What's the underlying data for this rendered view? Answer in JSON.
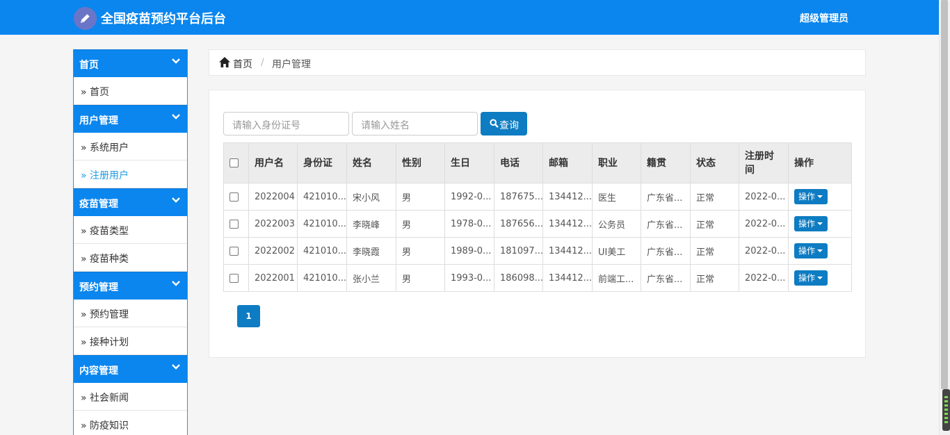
{
  "app": {
    "title": "全国疫苗预约平台后台",
    "user": "超级管理员",
    "logo_icon": "pencil-icon"
  },
  "sidebar": {
    "groups": [
      {
        "label": "首页",
        "items": [
          {
            "label": "首页"
          }
        ]
      },
      {
        "label": "用户管理",
        "items": [
          {
            "label": "系统用户"
          },
          {
            "label": "注册用户",
            "active": true
          }
        ]
      },
      {
        "label": "疫苗管理",
        "items": [
          {
            "label": "疫苗类型"
          },
          {
            "label": "疫苗种类"
          }
        ]
      },
      {
        "label": "预约管理",
        "items": [
          {
            "label": "预约管理"
          },
          {
            "label": "接种计划"
          }
        ]
      },
      {
        "label": "内容管理",
        "items": [
          {
            "label": "社会新闻"
          },
          {
            "label": "防疫知识"
          }
        ]
      }
    ]
  },
  "breadcrumb": {
    "home": "首页",
    "current": "用户管理"
  },
  "search": {
    "id_placeholder": "请输入身份证号",
    "name_placeholder": "请输入姓名",
    "button": "查询"
  },
  "table": {
    "headers": [
      "用户名",
      "身份证",
      "姓名",
      "性别",
      "生日",
      "电话",
      "邮箱",
      "职业",
      "籍贯",
      "状态",
      "注册时间",
      "操作"
    ],
    "rows": [
      [
        "2022004",
        "421010...",
        "宋小风",
        "男",
        "1992-0...",
        "187675...",
        "134412...",
        "医生",
        "广东省...",
        "正常",
        "2022-0...",
        "操作"
      ],
      [
        "2022003",
        "421010...",
        "李晓峰",
        "男",
        "1978-0...",
        "187656...",
        "134412...",
        "公务员",
        "广东省...",
        "正常",
        "2022-0...",
        "操作"
      ],
      [
        "2022002",
        "421010...",
        "李晓霞",
        "男",
        "1989-0...",
        "181097...",
        "134412...",
        "UI美工",
        "广东省...",
        "正常",
        "2022-0...",
        "操作"
      ],
      [
        "2022001",
        "421010...",
        "张小兰",
        "男",
        "1993-0...",
        "186098...",
        "134412...",
        "前端工...",
        "广东省...",
        "正常",
        "2022-0...",
        "操作"
      ]
    ]
  },
  "pagination": {
    "current": "1"
  },
  "colors": {
    "topbar": "#0a86ee",
    "button": "#0e7cc2",
    "active_link": "#1e9be5"
  }
}
